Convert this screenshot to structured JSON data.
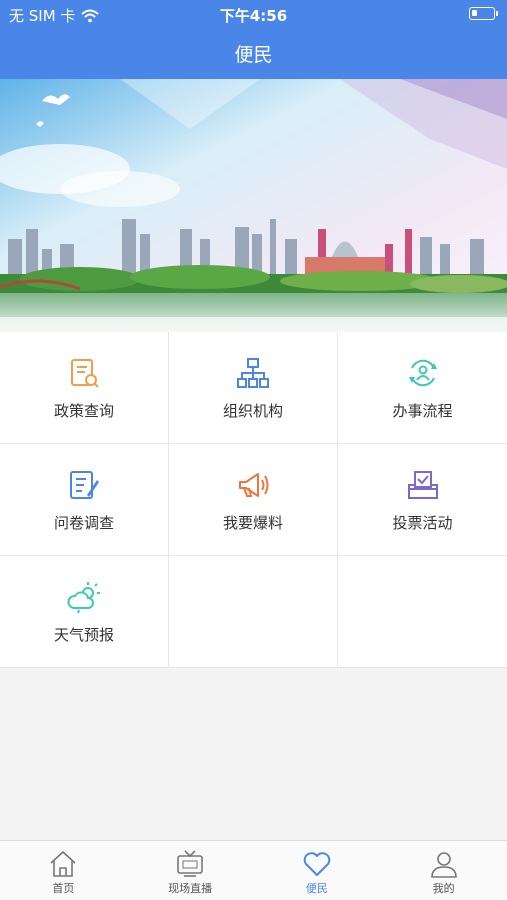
{
  "status_bar": {
    "carrier": "无 SIM 卡",
    "time": "下午4:56"
  },
  "header": {
    "title": "便民"
  },
  "services": [
    {
      "label": "政策查询",
      "icon": "policy-search-icon",
      "color": "#f39c4a"
    },
    {
      "label": "组织机构",
      "icon": "org-chart-icon",
      "color": "#4a86e8"
    },
    {
      "label": "办事流程",
      "icon": "process-cycle-icon",
      "color": "#3ccbb0"
    },
    {
      "label": "问卷调查",
      "icon": "survey-icon",
      "color": "#4a86e8"
    },
    {
      "label": "我要爆料",
      "icon": "megaphone-icon",
      "color": "#f0743c"
    },
    {
      "label": "投票活动",
      "icon": "ballot-box-icon",
      "color": "#7b68c9"
    },
    {
      "label": "天气预报",
      "icon": "weather-icon",
      "color": "#3ccbb0"
    }
  ],
  "tabbar": [
    {
      "label": "首页",
      "icon": "home-icon"
    },
    {
      "label": "现场直播",
      "icon": "live-tv-icon"
    },
    {
      "label": "便民",
      "icon": "heart-icon",
      "active": true
    },
    {
      "label": "我的",
      "icon": "user-icon"
    }
  ]
}
